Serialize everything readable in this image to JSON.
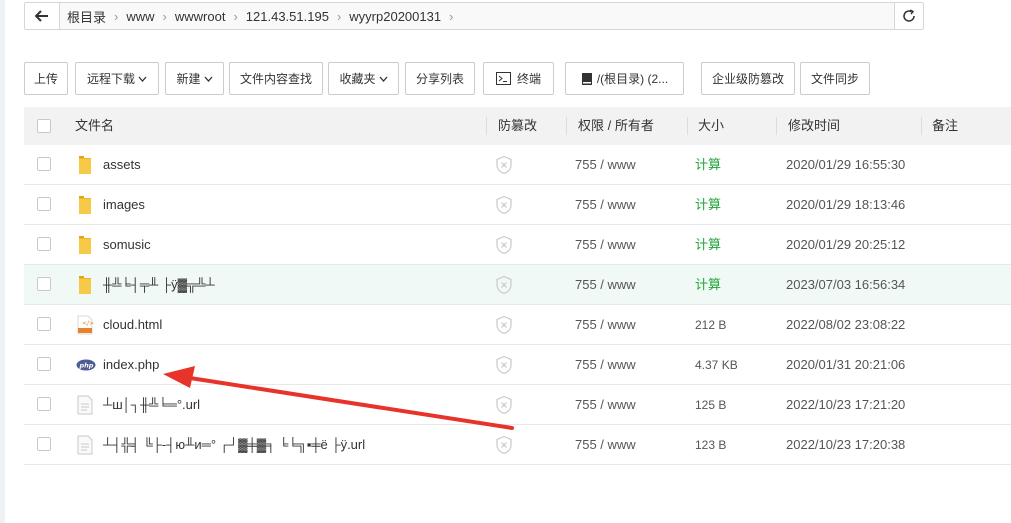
{
  "path": {
    "crumbs": [
      "根目录",
      "www",
      "wwwroot",
      "121.43.51.195",
      "wyyrp20200131"
    ]
  },
  "toolbar": {
    "upload": "上传",
    "remote_download": "远程下载",
    "new": "新建",
    "content_search": "文件内容查找",
    "favorites": "收藏夹",
    "share_list": "分享列表",
    "terminal": "终端",
    "disk": "/(根目录) (2...",
    "tamper_enterprise": "企业级防篡改",
    "file_sync": "文件同步"
  },
  "table": {
    "headers": {
      "name": "文件名",
      "tamper": "防篡改",
      "perm": "权限 / 所有者",
      "size": "大小",
      "mtime": "修改时间",
      "note": "备注"
    },
    "rows": [
      {
        "name": "assets",
        "type": "folder",
        "perm": "755 / www",
        "size": "计算",
        "mtime": "2020/01/29 16:55:30"
      },
      {
        "name": "images",
        "type": "folder",
        "perm": "755 / www",
        "size": "计算",
        "mtime": "2020/01/29 18:13:46"
      },
      {
        "name": "somusic",
        "type": "folder",
        "perm": "755 / www",
        "size": "计算",
        "mtime": "2020/01/29 20:25:12"
      },
      {
        "name": "╫╩╘┤╤╨ ├ÿ▓╦╩┴",
        "type": "folder",
        "perm": "755 / www",
        "size": "计算",
        "mtime": "2023/07/03 16:56:34"
      },
      {
        "name": "cloud.html",
        "type": "html",
        "perm": "755 / www",
        "size": "212 B",
        "mtime": "2022/08/02 23:08:22"
      },
      {
        "name": "index.php",
        "type": "php",
        "perm": "755 / www",
        "size": "4.37 KB",
        "mtime": "2020/01/31 20:21:06"
      },
      {
        "name": "┴ш│┐╫╩╘═°.url",
        "type": "file",
        "perm": "755 / www",
        "size": "125 B",
        "mtime": "2022/10/23 17:21:20"
      },
      {
        "name": "┴┤╬╡ ╚├-┤ю╨и═° ┌┘▓╪▓╕ ╘╘╗▪╪ё ├ÿ.url",
        "type": "file",
        "perm": "755 / www",
        "size": "123 B",
        "mtime": "2022/10/23 17:20:38"
      }
    ]
  },
  "colors": {
    "accent": "#20a53a",
    "arrow": "#e8332a",
    "highlight_row": "#f1f9f6"
  }
}
